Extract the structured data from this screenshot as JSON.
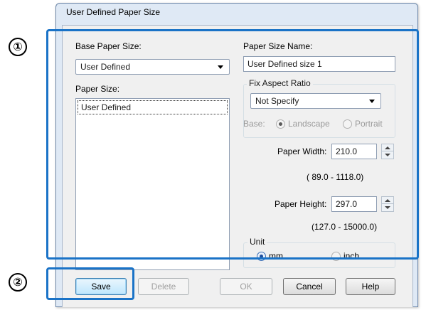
{
  "callouts": [
    "①",
    "②"
  ],
  "dialog": {
    "title": "User Defined Paper Size",
    "base_paper_size": {
      "label": "Base Paper Size:",
      "value": "User Defined"
    },
    "paper_size": {
      "label": "Paper Size:",
      "items": [
        "User Defined"
      ]
    },
    "paper_size_name": {
      "label": "Paper Size Name:",
      "value": "User Defined size 1"
    },
    "fix_aspect_ratio": {
      "legend": "Fix Aspect Ratio",
      "value": "Not Specify",
      "base_label": "Base:",
      "options": [
        "Landscape",
        "Portrait"
      ],
      "selected": "Landscape",
      "enabled": false
    },
    "paper_width": {
      "label": "Paper Width:",
      "value": "210.0",
      "range": "( 89.0 - 1118.0)"
    },
    "paper_height": {
      "label": "Paper Height:",
      "value": "297.0",
      "range": "(127.0 - 15000.0)"
    },
    "unit": {
      "legend": "Unit",
      "options": [
        "mm",
        "inch"
      ],
      "selected": "mm"
    },
    "buttons": {
      "save": "Save",
      "delete": "Delete",
      "ok": "OK",
      "cancel": "Cancel",
      "help": "Help"
    },
    "disabled_buttons": [
      "Delete",
      "OK"
    ]
  },
  "colors": {
    "highlight": "#1a73c7",
    "title_bar": "#dfe9f5",
    "client": "#f0f0f0"
  }
}
